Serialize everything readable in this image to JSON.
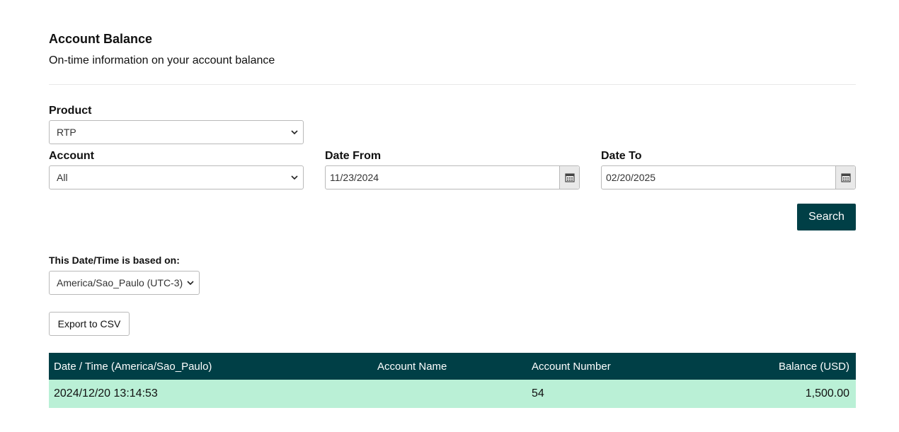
{
  "header": {
    "title": "Account Balance",
    "subtitle": "On-time information on your account balance"
  },
  "filters": {
    "product": {
      "label": "Product",
      "value": "RTP"
    },
    "account": {
      "label": "Account",
      "value": "All"
    },
    "date_from": {
      "label": "Date From",
      "value": "11/23/2024"
    },
    "date_to": {
      "label": "Date To",
      "value": "02/20/2025"
    },
    "search_label": "Search"
  },
  "timezone": {
    "label": "This Date/Time is based on:",
    "value": "America/Sao_Paulo (UTC-3)"
  },
  "export_label": "Export to CSV",
  "table": {
    "columns": [
      "Date / Time (America/Sao_Paulo)",
      "Account Name",
      "Account Number",
      "Balance (USD)"
    ],
    "rows": [
      {
        "datetime": "2024/12/20 13:14:53",
        "account_name": "",
        "account_number": "54",
        "balance": "1,500.00"
      }
    ]
  },
  "colors": {
    "header_bg": "#003f46",
    "row_bg": "#baf0d6",
    "button_bg": "#003f46"
  }
}
